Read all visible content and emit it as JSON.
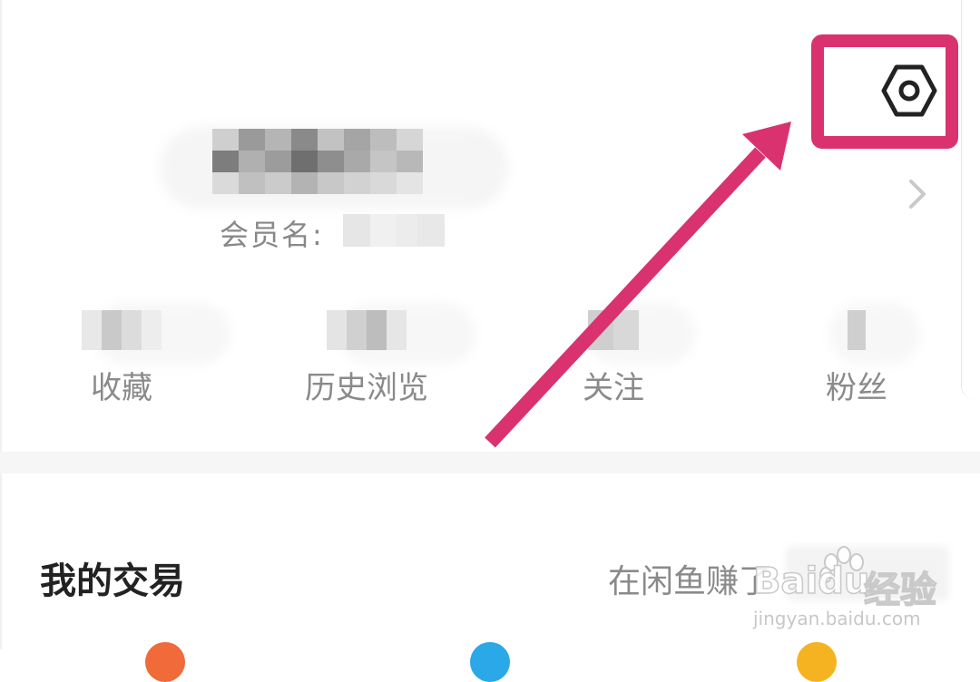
{
  "profile": {
    "member_name_label": "会员名:"
  },
  "stats": [
    {
      "label": "收藏"
    },
    {
      "label": "历史浏览"
    },
    {
      "label": "关注"
    },
    {
      "label": "粉丝"
    }
  ],
  "trade_section": {
    "title": "我的交易",
    "earned_text": "在闲鱼赚了"
  },
  "watermark": {
    "logo_text": "Baidu",
    "suffix": "经验",
    "url": "jingyan.baidu.com"
  },
  "icons": {
    "settings": "settings-hexagon-icon",
    "chevron": "chevron-right-icon"
  },
  "colors": {
    "highlight": "#d9326f",
    "arrow": "#d9326f"
  }
}
